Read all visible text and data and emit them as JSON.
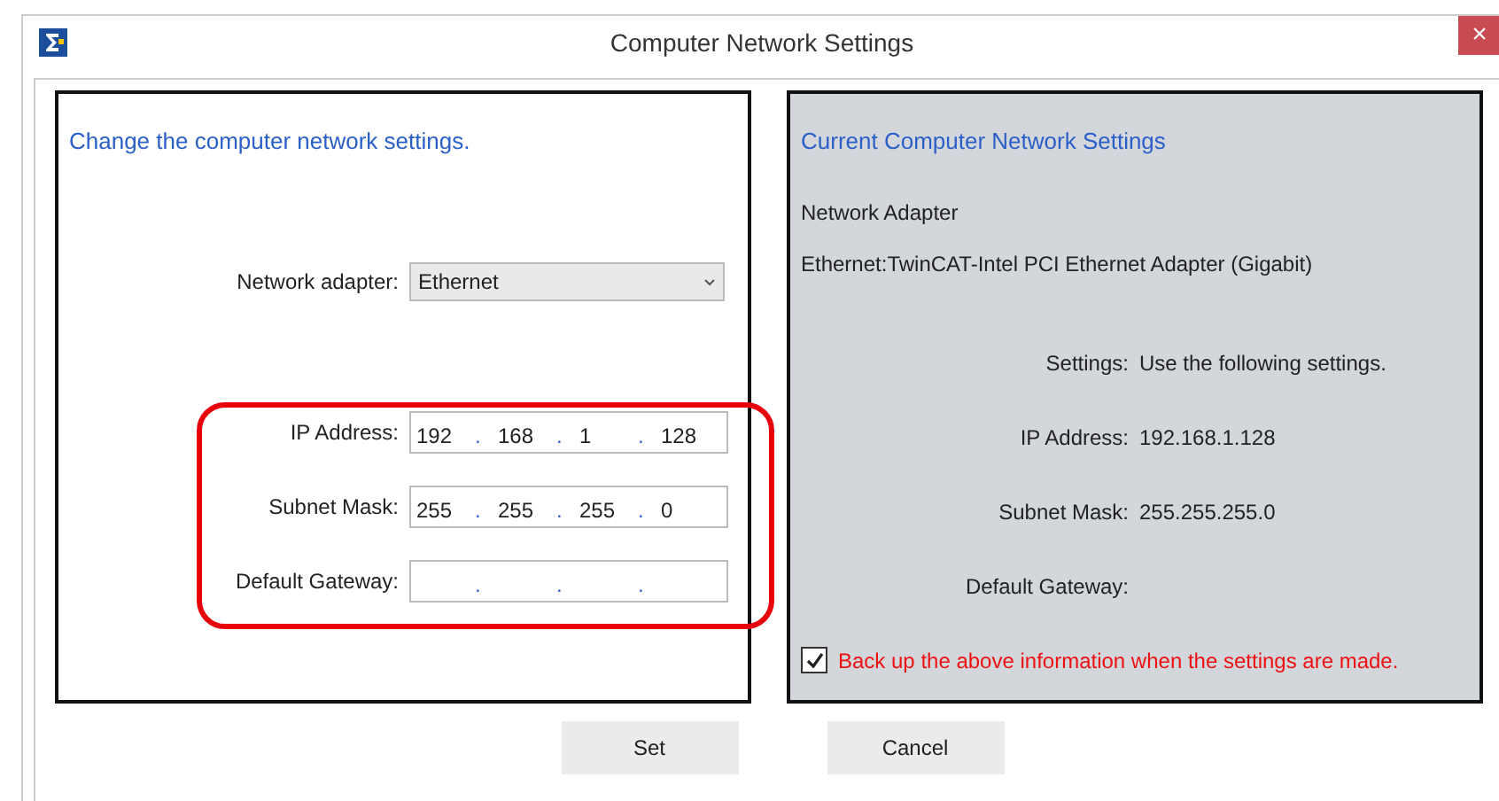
{
  "window": {
    "title": "Computer Network Settings",
    "close": "×"
  },
  "left": {
    "heading": "Change the computer network settings.",
    "adapter": {
      "label": "Network adapter:",
      "value": "Ethernet"
    },
    "fields": [
      {
        "label": "IP Address:",
        "octets": [
          "192",
          "168",
          "1",
          "128"
        ],
        "dots": [
          ".",
          ".",
          "."
        ]
      },
      {
        "label": "Subnet Mask:",
        "octets": [
          "255",
          "255",
          "255",
          "0"
        ],
        "dots": [
          ".",
          ".",
          "."
        ]
      },
      {
        "label": "Default Gateway:",
        "dots": [
          ".",
          ".",
          "."
        ]
      }
    ],
    "highlighted": true
  },
  "right": {
    "heading": "Current Computer Network Settings",
    "adapter_label": "Network Adapter",
    "adapter_name": "Ethernet:TwinCAT-Intel PCI Ethernet Adapter (Gigabit)",
    "rows": [
      {
        "label": "Settings:",
        "value": "Use the following settings."
      },
      {
        "label": "IP Address:",
        "value": "192.168.1.128"
      },
      {
        "label": "Subnet Mask:",
        "value": "255.255.255.0"
      },
      {
        "label": "Default Gateway:"
      }
    ],
    "backup": {
      "label": "Back up the above information when the settings are made.",
      "checked": true
    }
  },
  "buttons": [
    "Set",
    "Cancel"
  ]
}
